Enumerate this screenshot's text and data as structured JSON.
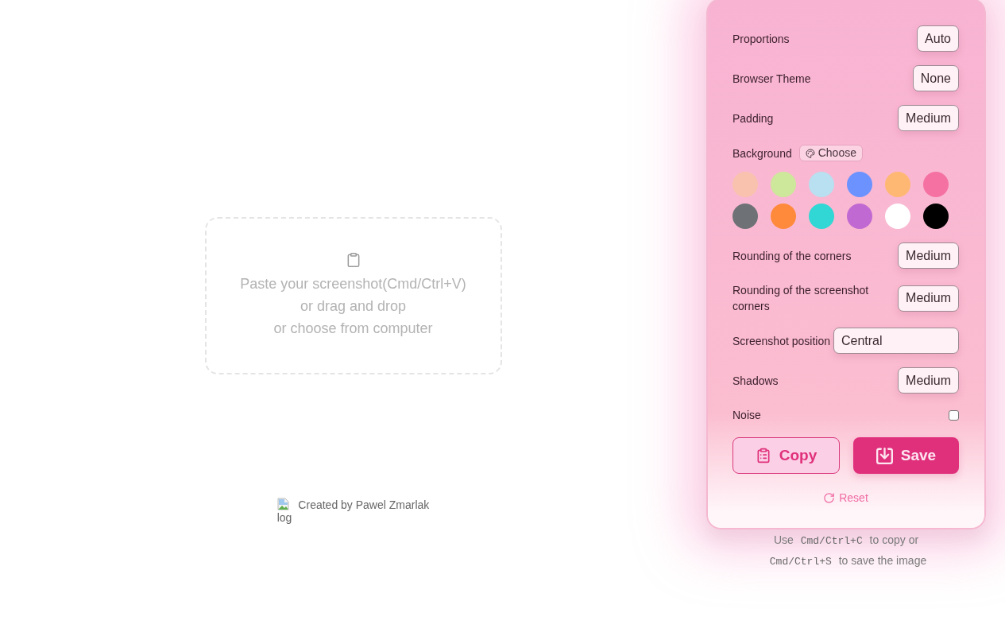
{
  "dropzone": {
    "lines": [
      "Paste your screenshot(Cmd/Ctrl+V)",
      "or drag and drop",
      "or choose from computer"
    ]
  },
  "credit": {
    "image_alt": "log",
    "text": "Created by Pawel Zmarlak"
  },
  "settings": {
    "rows": [
      {
        "kind": "select",
        "label": "Proportions",
        "value": "Auto"
      },
      {
        "kind": "select",
        "label": "Browser Theme",
        "value": "None"
      },
      {
        "kind": "select",
        "label": "Padding",
        "value": "Medium"
      },
      {
        "kind": "background",
        "label": "Background",
        "button": "Choose",
        "swatches": [
          {
            "color": "#f9c2ae"
          },
          {
            "color": "#cde89a"
          },
          {
            "color": "#b8e0f0"
          },
          {
            "color": "#6b92ff"
          },
          {
            "color": "#ffb873"
          },
          {
            "color": "#f571a2"
          },
          {
            "color": "#6e7277"
          },
          {
            "color": "#ff8a3c"
          },
          {
            "color": "#30d7d4"
          },
          {
            "color": "#c169d2"
          },
          {
            "color": "#ffffff"
          },
          {
            "color": "#000000"
          }
        ]
      },
      {
        "kind": "select",
        "label": "Rounding of the corners",
        "value": "Medium"
      },
      {
        "kind": "select",
        "label": "Rounding of the screenshot corners",
        "value": "Medium"
      },
      {
        "kind": "field",
        "label": "Screenshot position",
        "value": "Central"
      },
      {
        "kind": "select",
        "label": "Shadows",
        "value": "Medium"
      },
      {
        "kind": "checkbox",
        "label": "Noise",
        "checked": false
      }
    ],
    "actions": [
      {
        "kind": "outline",
        "label": "Copy"
      },
      {
        "kind": "filled",
        "label": "Save"
      }
    ],
    "reset": "Reset"
  },
  "hint": [
    {
      "kind": "text",
      "text": "Use"
    },
    {
      "kind": "key",
      "text": "Cmd/Ctrl+C"
    },
    {
      "kind": "text",
      "text": "to copy or"
    },
    {
      "kind": "key",
      "text": "Cmd/Ctrl+S"
    },
    {
      "kind": "text",
      "text": "to save the image"
    }
  ]
}
